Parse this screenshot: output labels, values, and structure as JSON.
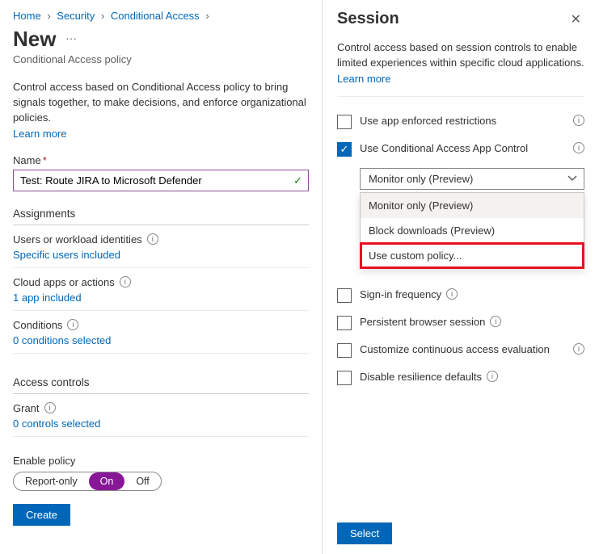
{
  "breadcrumb": [
    "Home",
    "Security",
    "Conditional Access"
  ],
  "page": {
    "title": "New",
    "subtitle": "Conditional Access policy",
    "description": "Control access based on Conditional Access policy to bring signals together, to make decisions, and enforce organizational policies.",
    "learn_more": "Learn more"
  },
  "name_field": {
    "label": "Name",
    "value": "Test: Route JIRA to Microsoft Defender"
  },
  "sections": {
    "assignments": "Assignments",
    "users": {
      "label": "Users or workload identities",
      "value": "Specific users included"
    },
    "apps": {
      "label": "Cloud apps or actions",
      "value": "1 app included"
    },
    "conditions": {
      "label": "Conditions",
      "value": "0 conditions selected"
    },
    "access_controls": "Access controls",
    "grant": {
      "label": "Grant",
      "value": "0 controls selected"
    }
  },
  "enable": {
    "label": "Enable policy",
    "options": [
      "Report-only",
      "On",
      "Off"
    ],
    "selected": "On"
  },
  "create_button": "Create",
  "panel": {
    "title": "Session",
    "description": "Control access based on session controls to enable limited experiences within specific cloud applications.",
    "learn_more": "Learn more",
    "checks": {
      "app_enforced": "Use app enforced restrictions",
      "app_control": "Use Conditional Access App Control",
      "signin_freq": "Sign-in frequency",
      "persistent": "Persistent browser session",
      "cont_access": "Customize continuous access evaluation",
      "resilience": "Disable resilience defaults"
    },
    "app_control_select": {
      "selected": "Monitor only (Preview)",
      "options": [
        "Monitor only (Preview)",
        "Block downloads (Preview)",
        "Use custom policy..."
      ]
    },
    "select_button": "Select"
  }
}
